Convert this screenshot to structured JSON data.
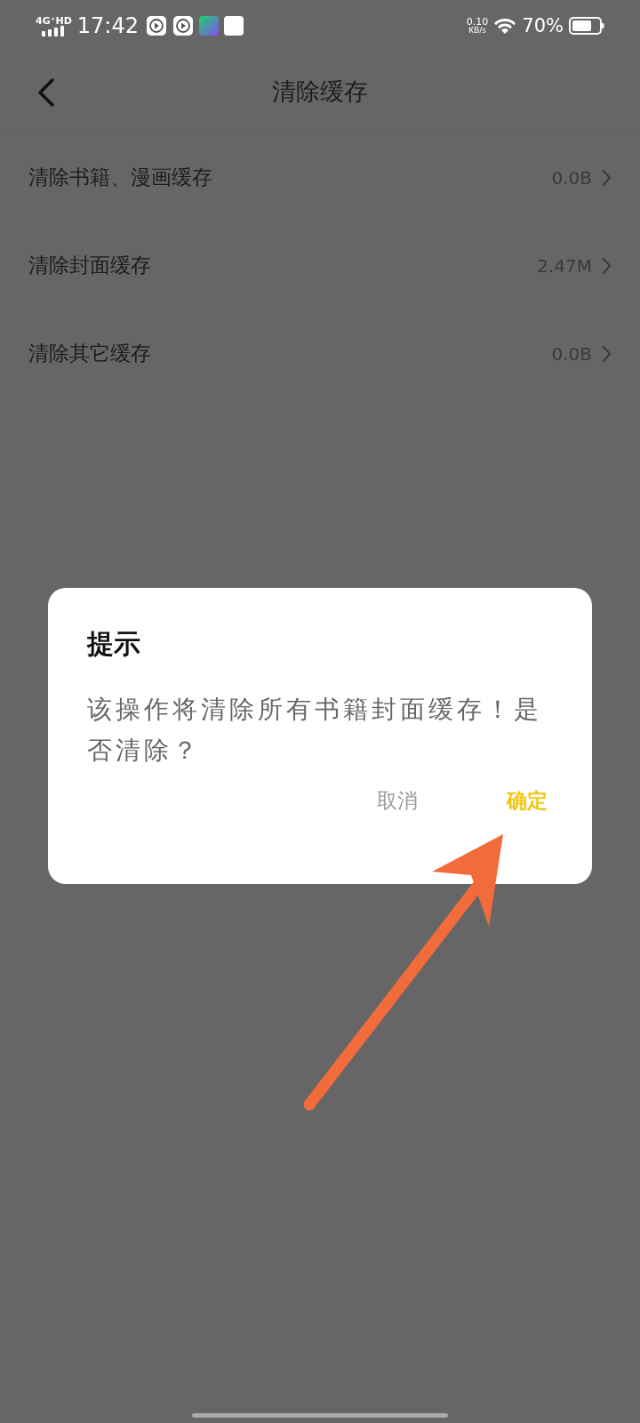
{
  "status_bar": {
    "network": "4G⁺HD",
    "time": "17:42",
    "speed": "0.10",
    "speed_unit": "KB/s",
    "battery": "70%"
  },
  "header": {
    "title": "清除缓存"
  },
  "rows": [
    {
      "label": "清除书籍、漫画缓存",
      "value": "0.0B"
    },
    {
      "label": "清除封面缓存",
      "value": "2.47M"
    },
    {
      "label": "清除其它缓存",
      "value": "0.0B"
    }
  ],
  "dialog": {
    "title": "提示",
    "message": "该操作将清除所有书籍封面缓存！是否清除？",
    "buttons": [
      {
        "label": "取消",
        "kind": "cancel"
      },
      {
        "label": "确定",
        "kind": "confirm"
      }
    ]
  }
}
